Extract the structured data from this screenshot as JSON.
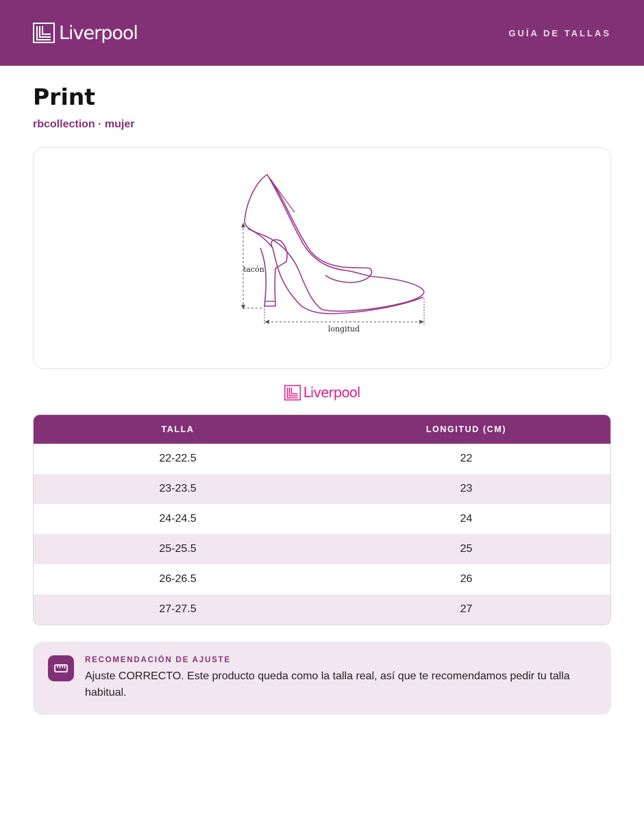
{
  "header": {
    "logo_text": "Liverpool",
    "link_label": "GUÍA DE TALLAS"
  },
  "product": {
    "title": "Print",
    "subtitle": "rbcollection · mujer"
  },
  "diagram": {
    "heel_label": "tacón",
    "length_label": "longitud"
  },
  "brand_logo_text": "Liverpool",
  "size_table": {
    "headers": [
      "TALLA",
      "LONGITUD (CM)"
    ],
    "rows": [
      [
        "22-22.5",
        "22"
      ],
      [
        "23-23.5",
        "23"
      ],
      [
        "24-24.5",
        "24"
      ],
      [
        "25-25.5",
        "25"
      ],
      [
        "26-26.5",
        "26"
      ],
      [
        "27-27.5",
        "27"
      ]
    ]
  },
  "fit_tip": {
    "title": "RECOMENDACIÓN DE AJUSTE",
    "text": "Ajuste CORRECTO. Este producto queda como la talla real, así que te recomendamos pedir tu talla habitual.",
    "icon": "ruler-icon"
  },
  "colors": {
    "brand": "#833177",
    "row_alt": "#f2e7f0",
    "logo_pink": "#e0218a"
  }
}
